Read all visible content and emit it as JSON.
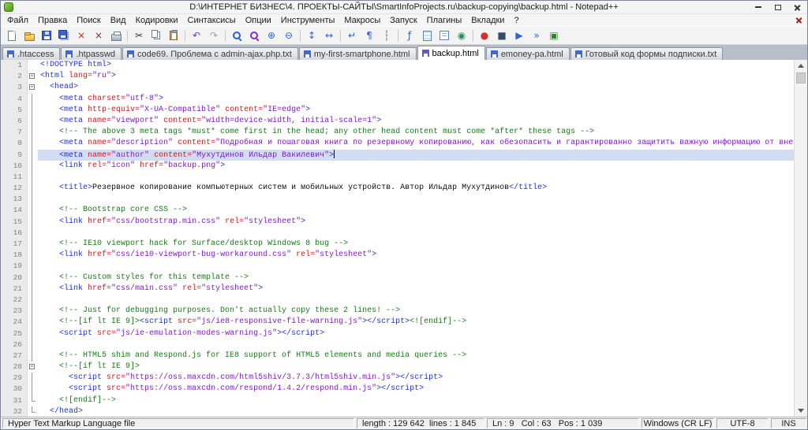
{
  "window": {
    "title": "D:\\ИНТЕРНЕТ БИЗНЕС\\4. ПРОЕКТЫ-САЙТЫ\\SmartInfoProjects.ru\\backup-copying\\backup.html - Notepad++"
  },
  "menubar": {
    "items": [
      {
        "id": "file",
        "label": "Файл"
      },
      {
        "id": "edit",
        "label": "Правка"
      },
      {
        "id": "search",
        "label": "Поиск"
      },
      {
        "id": "view",
        "label": "Вид"
      },
      {
        "id": "encoding",
        "label": "Кодировки"
      },
      {
        "id": "language",
        "label": "Синтаксисы"
      },
      {
        "id": "settings",
        "label": "Опции"
      },
      {
        "id": "tools",
        "label": "Инструменты"
      },
      {
        "id": "macro",
        "label": "Макросы"
      },
      {
        "id": "run",
        "label": "Запуск"
      },
      {
        "id": "plugins",
        "label": "Плагины"
      },
      {
        "id": "tabs",
        "label": "Вкладки"
      },
      {
        "id": "help",
        "label": "?"
      }
    ]
  },
  "toolbar": {
    "items": [
      {
        "id": "new-file"
      },
      {
        "id": "open-folder"
      },
      {
        "id": "save"
      },
      {
        "id": "save-all"
      },
      {
        "id": "close",
        "glyph": "×",
        "color": "#b03030"
      },
      {
        "id": "close-all",
        "glyph": "×",
        "color": "#703030"
      },
      {
        "id": "print"
      },
      {
        "sep": 1
      },
      {
        "id": "cut",
        "glyph": "✂",
        "color": "#3a3a3a"
      },
      {
        "id": "copy"
      },
      {
        "id": "paste"
      },
      {
        "sep": 1
      },
      {
        "id": "undo",
        "glyph": "↶",
        "color": "#7a2fd0"
      },
      {
        "id": "redo",
        "glyph": "↷",
        "color": "#a0a0a0"
      },
      {
        "sep": 1
      },
      {
        "id": "find"
      },
      {
        "id": "replace"
      },
      {
        "id": "zoom-in",
        "glyph": "⊕",
        "color": "#2a66d8"
      },
      {
        "id": "zoom-out",
        "glyph": "⊖",
        "color": "#2a66d8"
      },
      {
        "sep": 1
      },
      {
        "id": "sync-vertical",
        "glyph": "↕",
        "color": "#2a66d8"
      },
      {
        "id": "sync-horizontal",
        "glyph": "↔",
        "color": "#2a66d8"
      },
      {
        "sep": 1
      },
      {
        "id": "word-wrap",
        "glyph": "↵",
        "color": "#2a66d8"
      },
      {
        "id": "show-all-chars",
        "glyph": "¶",
        "color": "#4466cc"
      },
      {
        "id": "indent-guide",
        "glyph": "┆",
        "color": "#556677"
      },
      {
        "sep": 1
      },
      {
        "id": "function-list",
        "glyph": "ƒ",
        "color": "#335d8c"
      },
      {
        "id": "doc-map"
      },
      {
        "id": "doc-list"
      },
      {
        "id": "monitoring",
        "glyph": "◉",
        "color": "#2a8a5a"
      },
      {
        "sep": 1
      },
      {
        "id": "macro-record",
        "glyph": "●",
        "color": "#d03030"
      },
      {
        "id": "macro-stop",
        "glyph": "■",
        "color": "#334d66"
      },
      {
        "id": "macro-play",
        "glyph": "▶",
        "color": "#2a66d8"
      },
      {
        "id": "macro-run-multiple",
        "glyph": "»",
        "color": "#2a66d8"
      },
      {
        "id": "macro-save",
        "glyph": "▣",
        "color": "#2a8a2a"
      }
    ]
  },
  "tabs": {
    "items": [
      {
        "id": "htaccess",
        "label": ".htaccess",
        "state": "saved",
        "active": false
      },
      {
        "id": "htpasswd",
        "label": ".htpasswd",
        "state": "saved",
        "active": false
      },
      {
        "id": "code69",
        "label": "code69. Проблема с admin-ajax.php.txt",
        "state": "saved",
        "active": false
      },
      {
        "id": "my-first-smartphone",
        "label": "my-first-smartphone.html",
        "state": "saved",
        "active": false
      },
      {
        "id": "backup",
        "label": "backup.html",
        "state": "saved",
        "active": true
      },
      {
        "id": "emoney-pa",
        "label": "emoney-pa.html",
        "state": "saved",
        "active": false
      },
      {
        "id": "subscribe-form",
        "label": "Готовый код формы подписки.txt",
        "state": "saved",
        "active": false
      }
    ]
  },
  "editor": {
    "current_line": 9,
    "colors": {
      "tag": "#2233cc",
      "attr": "#cc2020",
      "value": "#8020c0",
      "comment": "#1a7a1a",
      "plain": "#101010",
      "line_number": "#808080",
      "current_line": "#d2dcf2"
    },
    "lines": [
      {
        "f": "",
        "t": [
          [
            "T",
            "<!DOCTYPE html>"
          ]
        ]
      },
      {
        "f": "box",
        "t": [
          [
            "T",
            "<html "
          ],
          [
            "A",
            "lang="
          ],
          [
            "V",
            "\"ru\""
          ],
          [
            "T",
            ">"
          ]
        ]
      },
      {
        "f": "box",
        "t": [
          [
            "P",
            "  "
          ],
          [
            "T",
            "<head>"
          ]
        ]
      },
      {
        "f": "line",
        "t": [
          [
            "P",
            "    "
          ],
          [
            "T",
            "<meta "
          ],
          [
            "A",
            "charset="
          ],
          [
            "V",
            "\"utf-8\""
          ],
          [
            "T",
            ">"
          ]
        ]
      },
      {
        "f": "line",
        "t": [
          [
            "P",
            "    "
          ],
          [
            "T",
            "<meta "
          ],
          [
            "A",
            "http-equiv="
          ],
          [
            "V",
            "\"X-UA-Compatible\""
          ],
          [
            "P",
            " "
          ],
          [
            "A",
            "content="
          ],
          [
            "V",
            "\"IE=edge\""
          ],
          [
            "T",
            ">"
          ]
        ]
      },
      {
        "f": "line",
        "t": [
          [
            "P",
            "    "
          ],
          [
            "T",
            "<meta "
          ],
          [
            "A",
            "name="
          ],
          [
            "V",
            "\"viewport\""
          ],
          [
            "P",
            " "
          ],
          [
            "A",
            "content="
          ],
          [
            "V",
            "\"width=device-width, initial-scale=1\""
          ],
          [
            "T",
            ">"
          ]
        ]
      },
      {
        "f": "line",
        "t": [
          [
            "P",
            "    "
          ],
          [
            "C",
            "<!-- The above 3 meta tags *must* come first in the head; any other head content must come *after* these tags -->"
          ]
        ]
      },
      {
        "f": "line",
        "t": [
          [
            "P",
            "    "
          ],
          [
            "T",
            "<meta "
          ],
          [
            "A",
            "name="
          ],
          [
            "V",
            "\"description\""
          ],
          [
            "P",
            " "
          ],
          [
            "A",
            "content="
          ],
          [
            "V",
            "\"Подробная и пошаговая книга по резервному копированию, как обезопасить и гарантированно защитить важную информацию от внез"
          ]
        ]
      },
      {
        "f": "line",
        "t": [
          [
            "P",
            "    "
          ],
          [
            "T",
            "<meta "
          ],
          [
            "A",
            "name="
          ],
          [
            "V",
            "\"author\""
          ],
          [
            "P",
            " "
          ],
          [
            "A",
            "content="
          ],
          [
            "V",
            "\"Мухутдинов Ильдар Вакилевич\""
          ],
          [
            "T",
            ">"
          ]
        ]
      },
      {
        "f": "line",
        "t": [
          [
            "P",
            "    "
          ],
          [
            "T",
            "<link "
          ],
          [
            "A",
            "rel="
          ],
          [
            "V",
            "\"icon\""
          ],
          [
            "P",
            " "
          ],
          [
            "A",
            "href="
          ],
          [
            "V",
            "\"backup.png\""
          ],
          [
            "T",
            ">"
          ]
        ]
      },
      {
        "f": "line",
        "t": []
      },
      {
        "f": "line",
        "t": [
          [
            "P",
            "    "
          ],
          [
            "T",
            "<title>"
          ],
          [
            "P",
            "Резервное копирование компьютерных систем и мобильных устройств. Автор Ильдар Мухутдинов"
          ],
          [
            "T",
            "</title>"
          ]
        ]
      },
      {
        "f": "line",
        "t": []
      },
      {
        "f": "line",
        "t": [
          [
            "P",
            "    "
          ],
          [
            "C",
            "<!-- Bootstrap core CSS -->"
          ]
        ]
      },
      {
        "f": "line",
        "t": [
          [
            "P",
            "    "
          ],
          [
            "T",
            "<link "
          ],
          [
            "A",
            "href="
          ],
          [
            "V",
            "\"css/bootstrap.min.css\""
          ],
          [
            "P",
            " "
          ],
          [
            "A",
            "rel="
          ],
          [
            "V",
            "\"stylesheet\""
          ],
          [
            "T",
            ">"
          ]
        ]
      },
      {
        "f": "line",
        "t": []
      },
      {
        "f": "line",
        "t": [
          [
            "P",
            "    "
          ],
          [
            "C",
            "<!-- IE10 viewport hack for Surface/desktop Windows 8 bug -->"
          ]
        ]
      },
      {
        "f": "line",
        "t": [
          [
            "P",
            "    "
          ],
          [
            "T",
            "<link "
          ],
          [
            "A",
            "href="
          ],
          [
            "V",
            "\"css/ie10-viewport-bug-workaround.css\""
          ],
          [
            "P",
            " "
          ],
          [
            "A",
            "rel="
          ],
          [
            "V",
            "\"stylesheet\""
          ],
          [
            "T",
            ">"
          ]
        ]
      },
      {
        "f": "line",
        "t": []
      },
      {
        "f": "line",
        "t": [
          [
            "P",
            "    "
          ],
          [
            "C",
            "<!-- Custom styles for this template -->"
          ]
        ]
      },
      {
        "f": "line",
        "t": [
          [
            "P",
            "    "
          ],
          [
            "T",
            "<link "
          ],
          [
            "A",
            "href="
          ],
          [
            "V",
            "\"css/main.css\""
          ],
          [
            "P",
            " "
          ],
          [
            "A",
            "rel="
          ],
          [
            "V",
            "\"stylesheet\""
          ],
          [
            "T",
            ">"
          ]
        ]
      },
      {
        "f": "line",
        "t": []
      },
      {
        "f": "line",
        "t": [
          [
            "P",
            "    "
          ],
          [
            "C",
            "<!-- Just for debugging purposes. Don't actually copy these 2 lines! -->"
          ]
        ]
      },
      {
        "f": "line",
        "t": [
          [
            "P",
            "    "
          ],
          [
            "C",
            "<!--[if lt IE 9]>"
          ],
          [
            "T",
            "<script "
          ],
          [
            "A",
            "src="
          ],
          [
            "V",
            "\"js/ie8-responsive-file-warning.js\""
          ],
          [
            "T",
            "></script>"
          ],
          [
            "C",
            "<![endif]-->"
          ]
        ]
      },
      {
        "f": "line",
        "t": [
          [
            "P",
            "    "
          ],
          [
            "T",
            "<script "
          ],
          [
            "A",
            "src="
          ],
          [
            "V",
            "\"js/ie-emulation-modes-warning.js\""
          ],
          [
            "T",
            "></script>"
          ]
        ]
      },
      {
        "f": "line",
        "t": []
      },
      {
        "f": "line",
        "t": [
          [
            "P",
            "    "
          ],
          [
            "C",
            "<!-- HTML5 shim and Respond.js for IE8 support of HTML5 elements and media queries -->"
          ]
        ]
      },
      {
        "f": "box",
        "t": [
          [
            "P",
            "    "
          ],
          [
            "C",
            "<!--[if lt IE 9]>"
          ]
        ]
      },
      {
        "f": "line",
        "t": [
          [
            "P",
            "      "
          ],
          [
            "T",
            "<script "
          ],
          [
            "A",
            "src="
          ],
          [
            "V",
            "\"https://oss.maxcdn.com/html5shiv/3.7.3/html5shiv.min.js\""
          ],
          [
            "T",
            "></script>"
          ]
        ]
      },
      {
        "f": "line",
        "t": [
          [
            "P",
            "      "
          ],
          [
            "T",
            "<script "
          ],
          [
            "A",
            "src="
          ],
          [
            "V",
            "\"https://oss.maxcdn.com/respond/1.4.2/respond.min.js\""
          ],
          [
            "T",
            "></script>"
          ]
        ]
      },
      {
        "f": "corner",
        "t": [
          [
            "P",
            "    "
          ],
          [
            "C",
            "<![endif]-->"
          ]
        ]
      },
      {
        "f": "corner",
        "t": [
          [
            "P",
            "  "
          ],
          [
            "T",
            "</head>"
          ]
        ]
      }
    ]
  },
  "statusbar": {
    "doc_type": "Hyper Text Markup Language file",
    "length_lines": "length : 129 642  lines : 1 845",
    "position": "Ln : 9   Col : 63   Pos : 1 039",
    "eol": "Windows (CR LF)",
    "encoding": "UTF-8",
    "mode": "INS"
  }
}
